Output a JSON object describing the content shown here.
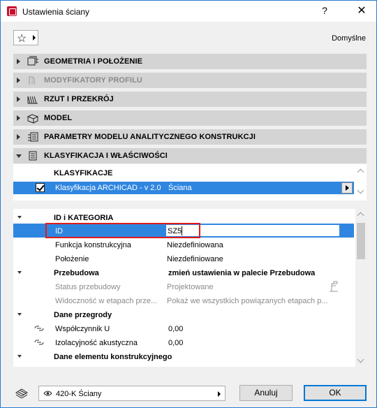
{
  "window": {
    "title": "Ustawienia ściany",
    "help": "?",
    "close": "✕"
  },
  "toolbar": {
    "favorites_star": "☆",
    "default_label": "Domyślne"
  },
  "panels": [
    {
      "label": "GEOMETRIA I POŁOŻENIE",
      "icon": "geometry-icon",
      "expanded": false,
      "enabled": true
    },
    {
      "label": "MODYFIKATORY PROFILU",
      "icon": "profile-modifier-icon",
      "expanded": false,
      "enabled": false
    },
    {
      "label": "RZUT I PRZEKRÓJ",
      "icon": "floor-plan-icon",
      "expanded": false,
      "enabled": true
    },
    {
      "label": "MODEL",
      "icon": "model-icon",
      "expanded": false,
      "enabled": true
    },
    {
      "label": "PARAMETRY MODELU ANALITYCZNEGO KONSTRUKCJI",
      "icon": "structural-analytical-icon",
      "expanded": false,
      "enabled": true
    },
    {
      "label": "KLASYFIKACJA I WŁAŚCIWOŚCI",
      "icon": "classification-icon",
      "expanded": true,
      "enabled": true
    }
  ],
  "classification": {
    "title": "KLASYFIKACJE",
    "row": {
      "checked": true,
      "name": "Klasyfikacja ARCHICAD - v 2.0",
      "value": "Ściana"
    }
  },
  "properties": {
    "id_group": {
      "title": "ID i KATEGORIA",
      "rows": [
        {
          "name": "ID",
          "value": "SZ5"
        },
        {
          "name": "Funkcja konstrukcyjna",
          "value": "Niezdefiniowana"
        },
        {
          "name": "Położenie",
          "value": "Niezdefiniowane"
        }
      ]
    },
    "renovation": {
      "title": "Przebudowa",
      "title_value": "zmień ustawienia w palecie Przebudowa",
      "rows": [
        {
          "name": "Status przebudowy",
          "value": "Projektowane"
        },
        {
          "name": "Widoczność w etapach prze...",
          "value": "Pokaż we wszystkich powiązanych etapach p..."
        }
      ]
    },
    "partition": {
      "title": "Dane przegrody",
      "rows": [
        {
          "name": "Współczynnik U",
          "value": "0,00"
        },
        {
          "name": "Izolacyjność akustyczna",
          "value": "0,00"
        }
      ]
    },
    "structural": {
      "title": "Dane elementu konstrukcyjnego"
    }
  },
  "footer": {
    "view_select": "420-K Ściany",
    "cancel_label": "Anuluj",
    "ok_label": "OK"
  },
  "colors": {
    "selection": "#2f86e0",
    "highlight_box": "#e21a1a",
    "panel_header": "#d4d4d4"
  }
}
